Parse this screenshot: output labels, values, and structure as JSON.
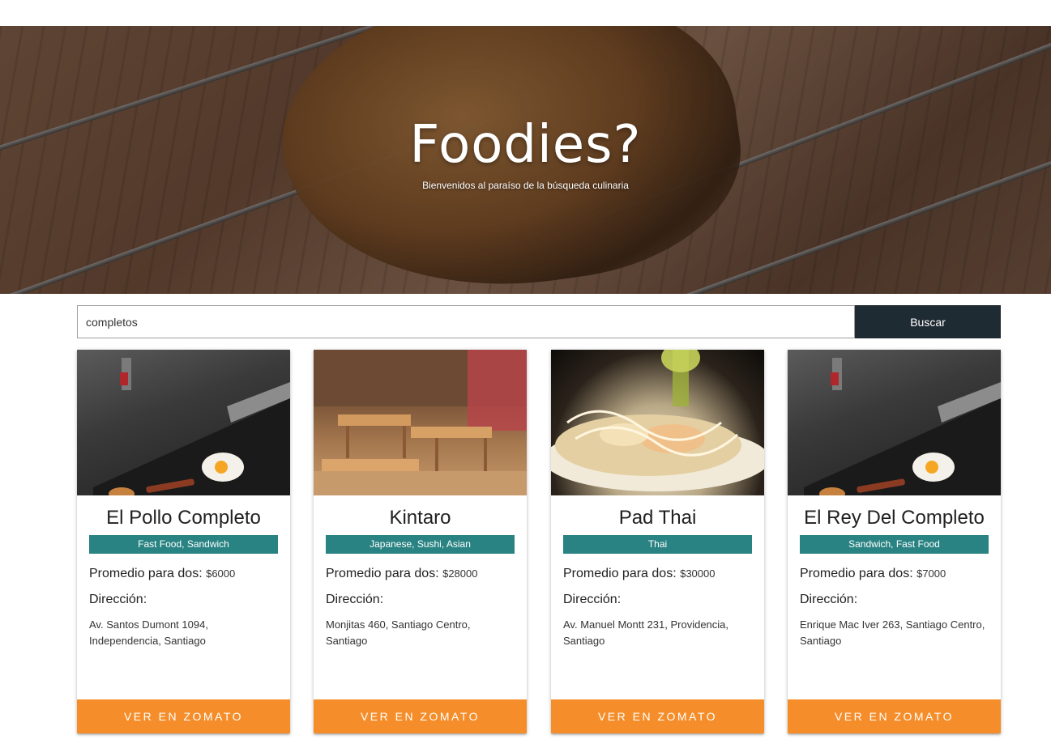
{
  "hero": {
    "title": "Foodies?",
    "subtitle": "Bienvenidos al paraíso de la búsqueda culinaria"
  },
  "search": {
    "value": "completos",
    "button_label": "Buscar"
  },
  "labels": {
    "price": "Promedio para dos:",
    "address": "Dirección:",
    "cta": "VER EN ZOMATO"
  },
  "colors": {
    "accent": "#f58e2a",
    "tag": "#2a8383",
    "search_button": "#1f2b33"
  },
  "restaurants": [
    {
      "name": "El Pollo Completo",
      "cuisines": "Fast Food, Sandwich",
      "price": "$6000",
      "address": "Av. Santos Dumont 1094, Independencia, Santiago",
      "image": "griddle-egg-photo"
    },
    {
      "name": "Kintaro",
      "cuisines": "Japanese, Sushi, Asian",
      "price": "$28000",
      "address": "Monjitas 460, Santiago Centro, Santiago",
      "image": "restaurant-interior-photo"
    },
    {
      "name": "Pad Thai",
      "cuisines": "Thai",
      "price": "$30000",
      "address": "Av. Manuel Montt 231, Providencia, Santiago",
      "image": "pad-thai-dish-photo"
    },
    {
      "name": "El Rey Del Completo",
      "cuisines": "Sandwich, Fast Food",
      "price": "$7000",
      "address": "Enrique Mac Iver 263, Santiago Centro, Santiago",
      "image": "griddle-egg-photo"
    }
  ]
}
